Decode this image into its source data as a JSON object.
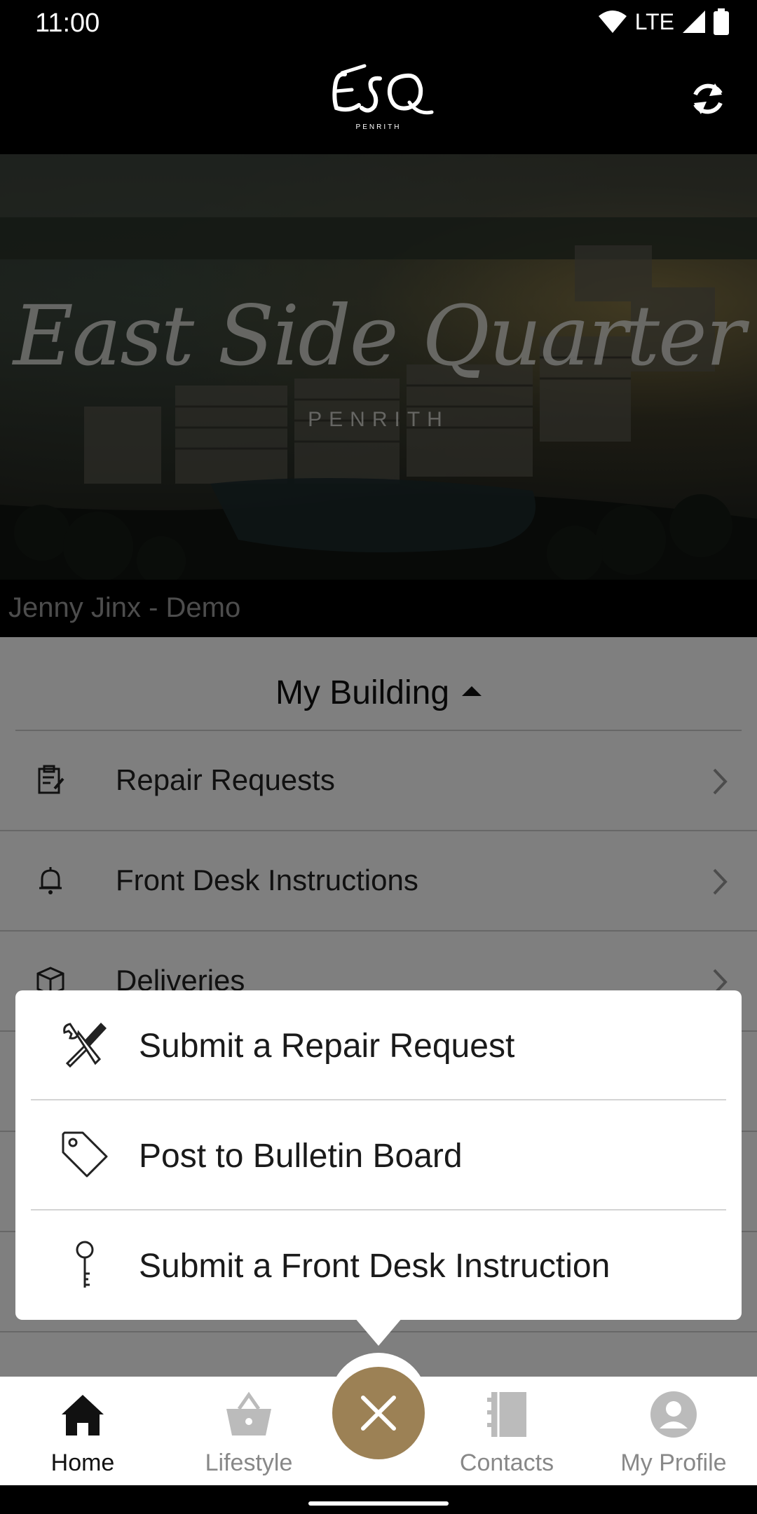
{
  "status_bar": {
    "time": "11:00",
    "network": "LTE"
  },
  "header": {
    "logo_text": "ESQ",
    "logo_subtext": "PENRITH"
  },
  "hero": {
    "script_title": "East Side Quarter",
    "subtitle": "PENRITH"
  },
  "user": {
    "name": "Jenny Jinx - Demo"
  },
  "section": {
    "title": "My Building",
    "items": [
      {
        "label": "Repair Requests",
        "icon": "clipboard-icon"
      },
      {
        "label": "Front Desk Instructions",
        "icon": "bell-icon"
      },
      {
        "label": "Deliveries",
        "icon": "package-icon"
      }
    ]
  },
  "popup": {
    "items": [
      {
        "label": "Submit a Repair Request",
        "icon": "tools-icon"
      },
      {
        "label": "Post to Bulletin Board",
        "icon": "tag-icon"
      },
      {
        "label": "Submit a Front Desk Instruction",
        "icon": "key-icon"
      }
    ]
  },
  "nav": {
    "items": [
      {
        "label": "Home",
        "icon": "home-icon",
        "active": true
      },
      {
        "label": "Lifestyle",
        "icon": "basket-icon",
        "active": false
      },
      {
        "label": "Contacts",
        "icon": "contacts-book-icon",
        "active": false
      },
      {
        "label": "My Profile",
        "icon": "profile-icon",
        "active": false
      }
    ],
    "fab_icon": "close-icon"
  },
  "colors": {
    "accent": "#9c8155",
    "background": "#000000"
  }
}
